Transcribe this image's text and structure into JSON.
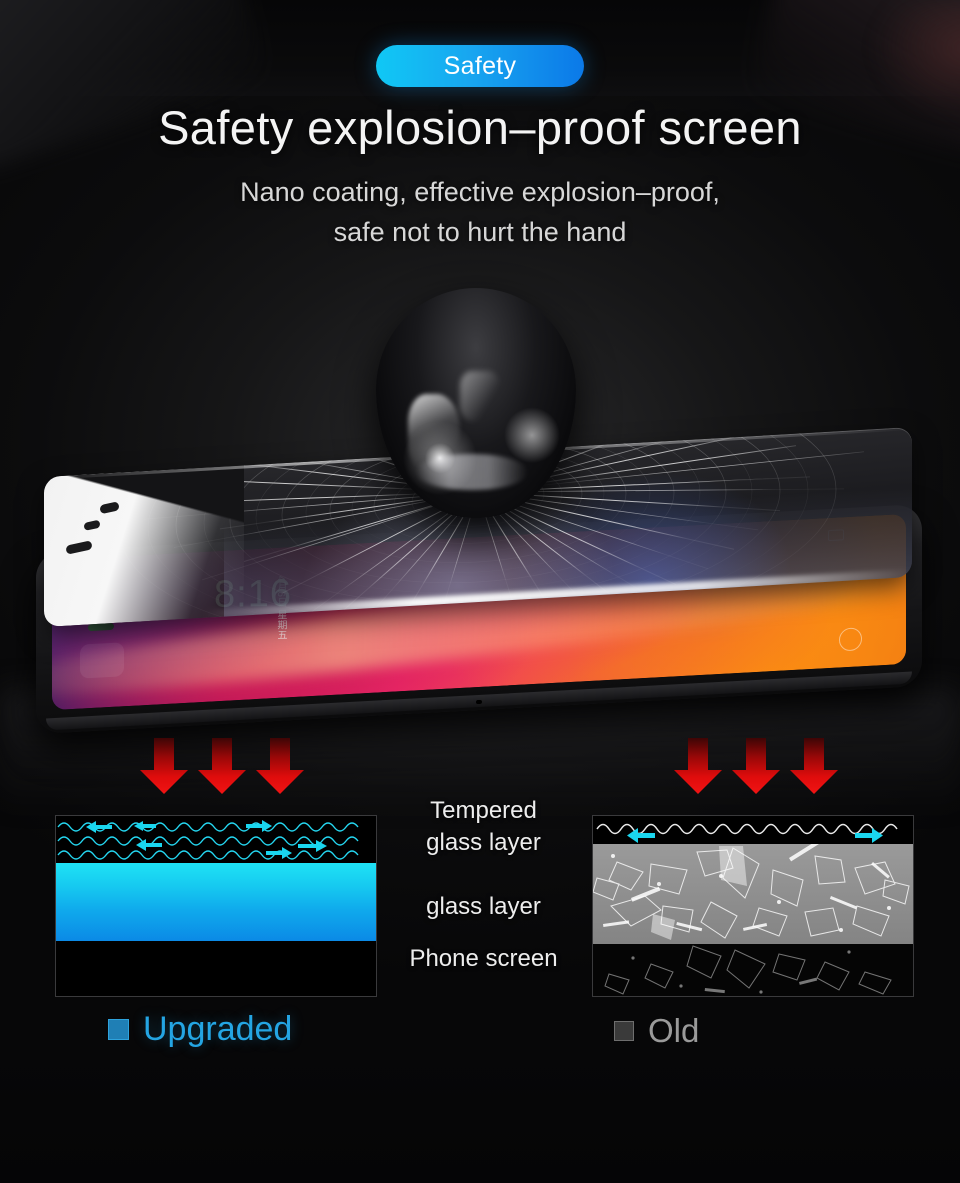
{
  "badge": {
    "label": "Safety"
  },
  "headline": "Safety explosion–proof screen",
  "subhead": {
    "line1": "Nano coating, effective explosion–proof,",
    "line2": "safe not to hurt the hand"
  },
  "hero": {
    "phone_clock": "8:16",
    "phone_date": "4月6日 星期五",
    "glass_sheet_state": "cracked tempered glass",
    "impact_object": "steel ball"
  },
  "layer_labels": {
    "tempered_glass_line1": "Tempered",
    "tempered_glass_line2": "glass layer",
    "glass_layer": "glass layer",
    "phone_screen": "Phone screen"
  },
  "legend": {
    "upgraded": "Upgraded",
    "old": "Old"
  },
  "colors": {
    "badge_start": "#10c8f5",
    "badge_end": "#0b79e8",
    "upgraded_accent": "#24a5e3",
    "old_accent": "#9a9a9a",
    "arrow_red": "#e20a0a",
    "wave_cyan": "#25d8f2",
    "glass_layer_top": "#1fe3f5",
    "glass_layer_bottom": "#0b8ae6",
    "shard_band": "#8e8e8e"
  },
  "icons": {
    "down_arrow": "down-arrow-icon",
    "left_arrow": "left-arrow-icon",
    "right_arrow": "right-arrow-icon",
    "legend_square": "square-marker-icon"
  },
  "arrow_groups": {
    "left": {
      "count": 3,
      "direction": "down"
    },
    "right": {
      "count": 3,
      "direction": "down"
    }
  }
}
